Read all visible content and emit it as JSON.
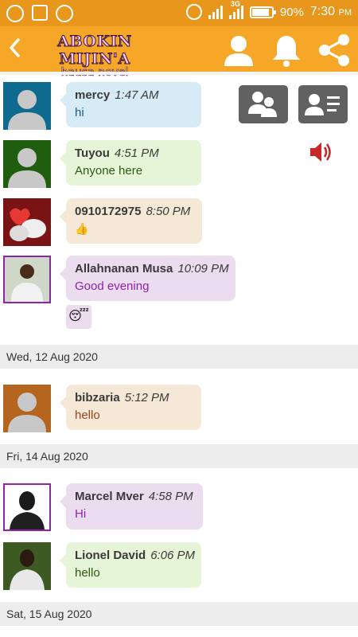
{
  "status": {
    "battery": "90%",
    "time": "7:30",
    "ampm": "PM",
    "network": "3G",
    "battery_level": 0.9
  },
  "app": {
    "title": "ABOKIN MIJIN'A",
    "subtitle": "hausa novel"
  },
  "toolbar": {
    "icons": [
      "back-icon",
      "profile-icon",
      "bell-icon",
      "share-icon"
    ]
  },
  "messages": [
    {
      "name": "mercy",
      "time": "1:47 AM",
      "text": "hi",
      "bubble": "#d6ebf5",
      "text_color": "#1c5a8a"
    },
    {
      "name": "Tuyou",
      "time": "4:51 PM",
      "text": "Anyone here",
      "bubble": "#e6f4d8",
      "text_color": "#2d5a12"
    },
    {
      "name": "0910172975",
      "time": "8:50 PM",
      "text": "👍",
      "bubble": "#f5e8d6",
      "text_color": "#c0392b"
    },
    {
      "name": "Allahnanan Musa",
      "time": "10:09 PM",
      "text": "Good evening",
      "bubble": "#ebdcef",
      "text_color": "#8e24aa",
      "extra": "😴"
    },
    {
      "name": "bibzaria",
      "time": "5:12 PM",
      "text": "hello",
      "bubble": "#f5e8d6",
      "text_color": "#a0421c"
    },
    {
      "name": "Marcel Mver",
      "time": "4:58 PM",
      "text": "Hi",
      "bubble": "#ebdcef",
      "text_color": "#8e24aa"
    },
    {
      "name": "Lionel David",
      "time": "6:06 PM",
      "text": "hello",
      "bubble": "#e6f4d8",
      "text_color": "#2d5a12"
    }
  ],
  "dates": [
    "Wed, 12 Aug 2020",
    "Fri, 14 Aug 2020",
    "Sat, 15 Aug 2020"
  ],
  "colors": {
    "statusbar": "#e8961c",
    "toolbar": "#f6a728",
    "button": "#616161",
    "speaker": "#c62828"
  }
}
